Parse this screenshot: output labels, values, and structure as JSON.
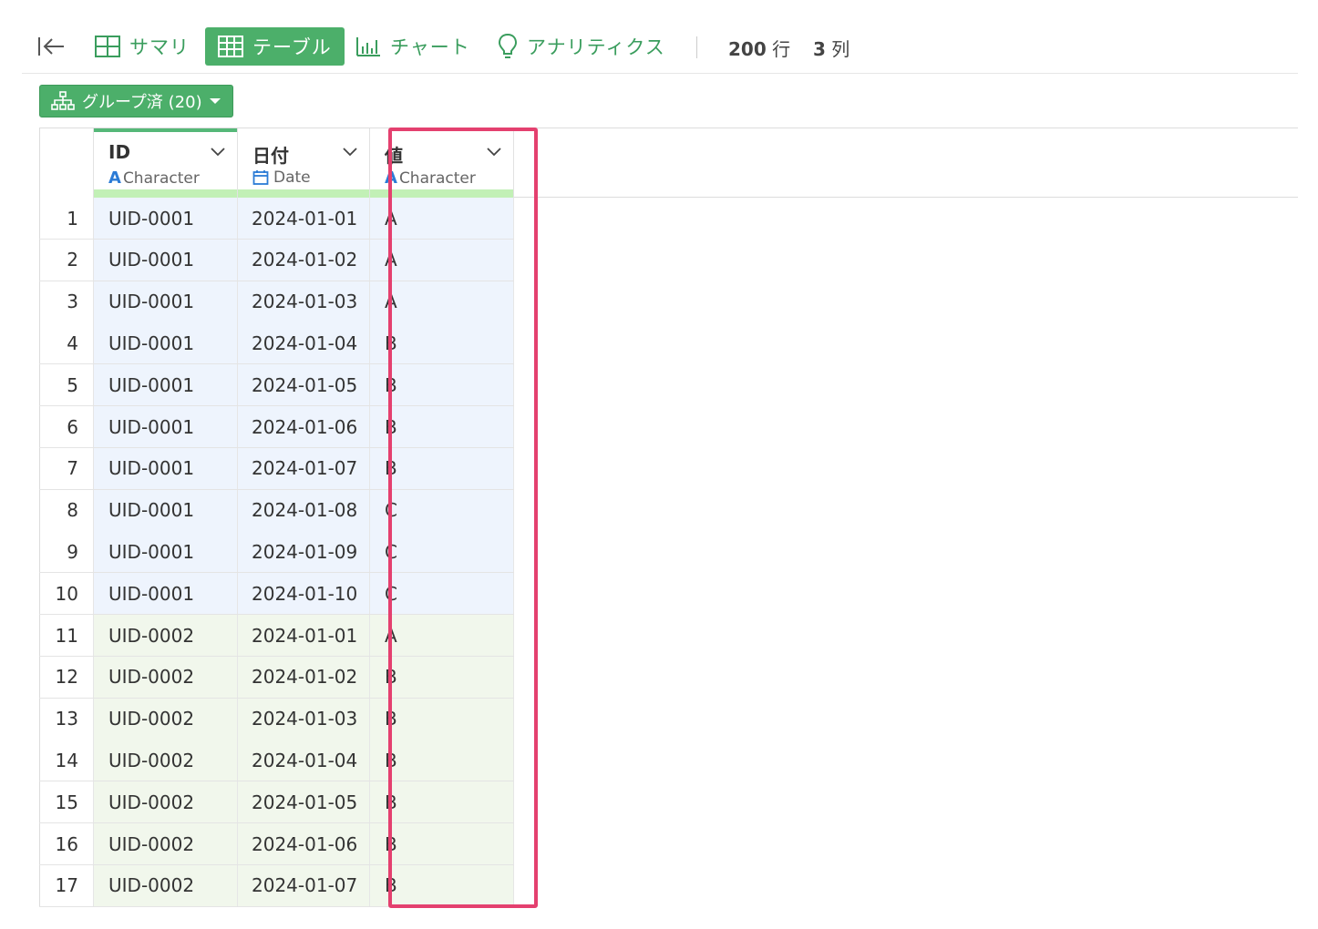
{
  "toolbar": {
    "tabs": [
      {
        "label": "サマリ",
        "icon": "summary-grid-icon"
      },
      {
        "label": "テーブル",
        "icon": "table-grid-icon"
      },
      {
        "label": "チャート",
        "icon": "bar-chart-icon"
      },
      {
        "label": "アナリティクス",
        "icon": "lightbulb-icon"
      }
    ],
    "active_tab": "テーブル",
    "row_count": "200",
    "row_unit": "行",
    "col_count": "3",
    "col_unit": "列"
  },
  "group_button": {
    "label": "グループ済 (20)",
    "icon": "hierarchy-icon"
  },
  "columns": [
    {
      "name": "ID",
      "type": "Character",
      "type_icon": "A"
    },
    {
      "name": "日付",
      "type": "Date",
      "type_icon": "calendar-icon"
    },
    {
      "name": "値",
      "type": "Character",
      "type_icon": "A"
    }
  ],
  "rows": [
    {
      "index": "1",
      "id": "UID-0001",
      "date": "2024-01-01",
      "value": "A"
    },
    {
      "index": "2",
      "id": "UID-0001",
      "date": "2024-01-02",
      "value": "A"
    },
    {
      "index": "3",
      "id": "UID-0001",
      "date": "2024-01-03",
      "value": "A"
    },
    {
      "index": "4",
      "id": "UID-0001",
      "date": "2024-01-04",
      "value": "B"
    },
    {
      "index": "5",
      "id": "UID-0001",
      "date": "2024-01-05",
      "value": "B"
    },
    {
      "index": "6",
      "id": "UID-0001",
      "date": "2024-01-06",
      "value": "B"
    },
    {
      "index": "7",
      "id": "UID-0001",
      "date": "2024-01-07",
      "value": "B"
    },
    {
      "index": "8",
      "id": "UID-0001",
      "date": "2024-01-08",
      "value": "C"
    },
    {
      "index": "9",
      "id": "UID-0001",
      "date": "2024-01-09",
      "value": "C"
    },
    {
      "index": "10",
      "id": "UID-0001",
      "date": "2024-01-10",
      "value": "C"
    },
    {
      "index": "11",
      "id": "UID-0002",
      "date": "2024-01-01",
      "value": "A"
    },
    {
      "index": "12",
      "id": "UID-0002",
      "date": "2024-01-02",
      "value": "B"
    },
    {
      "index": "13",
      "id": "UID-0002",
      "date": "2024-01-03",
      "value": "B"
    },
    {
      "index": "14",
      "id": "UID-0002",
      "date": "2024-01-04",
      "value": "B"
    },
    {
      "index": "15",
      "id": "UID-0002",
      "date": "2024-01-05",
      "value": "B"
    },
    {
      "index": "16",
      "id": "UID-0002",
      "date": "2024-01-06",
      "value": "B"
    },
    {
      "index": "17",
      "id": "UID-0002",
      "date": "2024-01-07",
      "value": "B"
    }
  ],
  "colors": {
    "accent": "#4caf6a",
    "group1_bg": "#eef4fd",
    "group2_bg": "#f1f7ec",
    "highlight": "#e4406f",
    "type_bar": "#c2f0b6"
  }
}
